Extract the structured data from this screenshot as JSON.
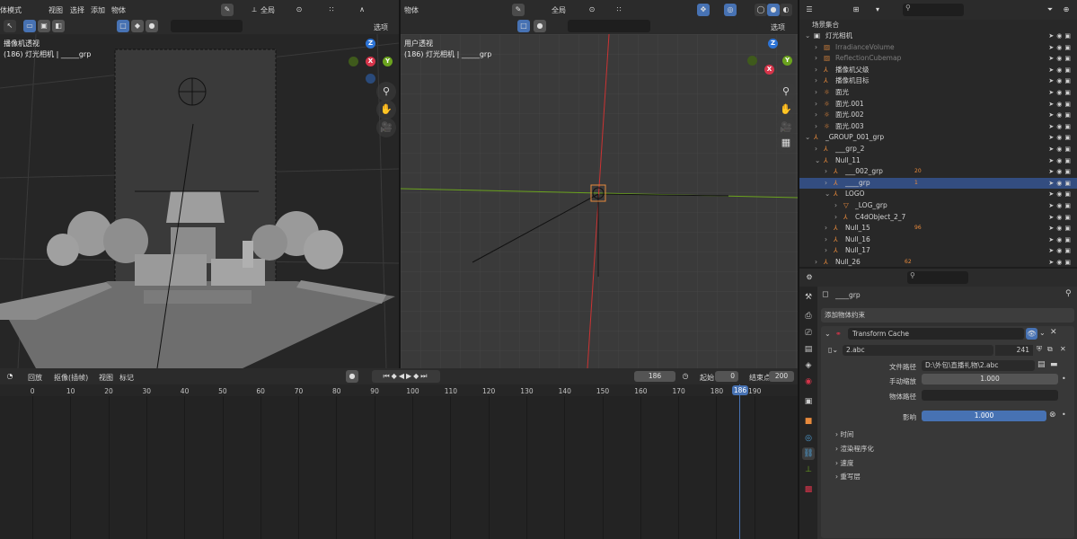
{
  "left_header": {
    "mode": "体模式",
    "menus": [
      "视图",
      "选择",
      "添加",
      "物体"
    ],
    "transform": "全局",
    "options": "选项"
  },
  "mid_header": {
    "menu": "物体",
    "transform": "全局",
    "options": "选项"
  },
  "viewport_left": {
    "title": "播像机透视",
    "subtitle": "(186) 灯光相机 | _____grp"
  },
  "viewport_right": {
    "title": "用户透视",
    "subtitle": "(186) 灯光相机 | _____grp"
  },
  "axes": {
    "x": "X",
    "y": "Y",
    "z": "Z"
  },
  "outliner": {
    "title": "场景集合",
    "rows": [
      {
        "label": "灯光相机",
        "indent": 0,
        "icon": "collection"
      },
      {
        "label": "IrradianceVolume",
        "indent": 1,
        "icon": "probe",
        "dim": true
      },
      {
        "label": "ReflectionCubemap",
        "indent": 1,
        "icon": "probe",
        "dim": true
      },
      {
        "label": "播像机父级",
        "indent": 1,
        "icon": "empty"
      },
      {
        "label": "播像机目标",
        "indent": 1,
        "icon": "empty"
      },
      {
        "label": "面光",
        "indent": 1,
        "icon": "light"
      },
      {
        "label": "面光.001",
        "indent": 1,
        "icon": "light"
      },
      {
        "label": "面光.002",
        "indent": 1,
        "icon": "light"
      },
      {
        "label": "面光.003",
        "indent": 1,
        "icon": "light"
      },
      {
        "label": "_GROUP_001_grp",
        "indent": 0,
        "icon": "empty"
      },
      {
        "label": "___grp_2",
        "indent": 1,
        "icon": "empty"
      },
      {
        "label": "Null_11",
        "indent": 1,
        "icon": "empty"
      },
      {
        "label": "___002_grp",
        "indent": 2,
        "icon": "empty",
        "badge": "20"
      },
      {
        "label": "____grp",
        "indent": 2,
        "icon": "empty",
        "badge": "1",
        "selected": true
      },
      {
        "label": "LOGO",
        "indent": 2,
        "icon": "empty"
      },
      {
        "label": "_LOG_grp",
        "indent": 3,
        "icon": "mesh"
      },
      {
        "label": "C4dObject_2_7",
        "indent": 3,
        "icon": "empty"
      },
      {
        "label": "Null_15",
        "indent": 2,
        "icon": "empty",
        "badge": "96"
      },
      {
        "label": "Null_16",
        "indent": 2,
        "icon": "empty"
      },
      {
        "label": "Null_17",
        "indent": 2,
        "icon": "empty"
      },
      {
        "label": "Null_26",
        "indent": 1,
        "icon": "empty",
        "badge": "62"
      }
    ]
  },
  "properties": {
    "object_name": "____grp",
    "add_constraint": "添加物体约束",
    "constraint_name": "Transform Cache",
    "cache_file": "2.abc",
    "cache_users": "241",
    "fields": [
      {
        "label": "文件路径",
        "value": "D:\\外包\\直播礼物\\2.abc"
      },
      {
        "label": "手动缩放",
        "value": "1.000"
      },
      {
        "label": "物体路径",
        "value": ""
      },
      {
        "label": "影响",
        "value": "1.000"
      }
    ],
    "sections": [
      "时间",
      "渲染程序化",
      "速度",
      "重写层"
    ]
  },
  "timeline": {
    "menus": [
      "回放",
      "抠像(插帧)",
      "视图",
      "标记"
    ],
    "current_frame": "186",
    "start_label": "起始",
    "start": "0",
    "end_label": "结束点",
    "end": "200",
    "ticks": [
      "0",
      "10",
      "20",
      "30",
      "40",
      "50",
      "60",
      "70",
      "80",
      "90",
      "100",
      "110",
      "120",
      "130",
      "140",
      "150",
      "160",
      "170",
      "180",
      "186",
      "190"
    ]
  },
  "colors": {
    "accent": "#4772b3",
    "selected_row": "#334d80",
    "x_axis": "#d6344a",
    "y_axis": "#6ba31e",
    "z_axis": "#2d74d6",
    "empty_icon": "#e88a3c",
    "data_icon": "#4ea0d8"
  }
}
